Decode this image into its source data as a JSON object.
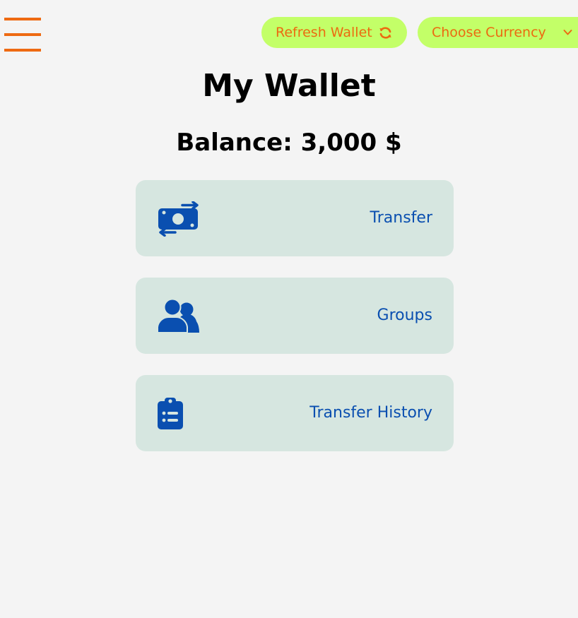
{
  "header": {
    "refresh_label": "Refresh Wallet",
    "currency_placeholder": "Choose Currency"
  },
  "main": {
    "title": "My Wallet",
    "balance": "Balance: 3,000 $"
  },
  "actions": [
    {
      "label": "Transfer",
      "icon": "money-transfer-icon"
    },
    {
      "label": "Groups",
      "icon": "users-icon"
    },
    {
      "label": "Transfer History",
      "icon": "clipboard-list-icon"
    }
  ],
  "colors": {
    "accent_orange": "#ec6a10",
    "pill_green": "#c3ff68",
    "card_bg": "#d6e6e0",
    "card_text_blue": "#0a4fb0",
    "page_bg": "#f4f4f4"
  }
}
